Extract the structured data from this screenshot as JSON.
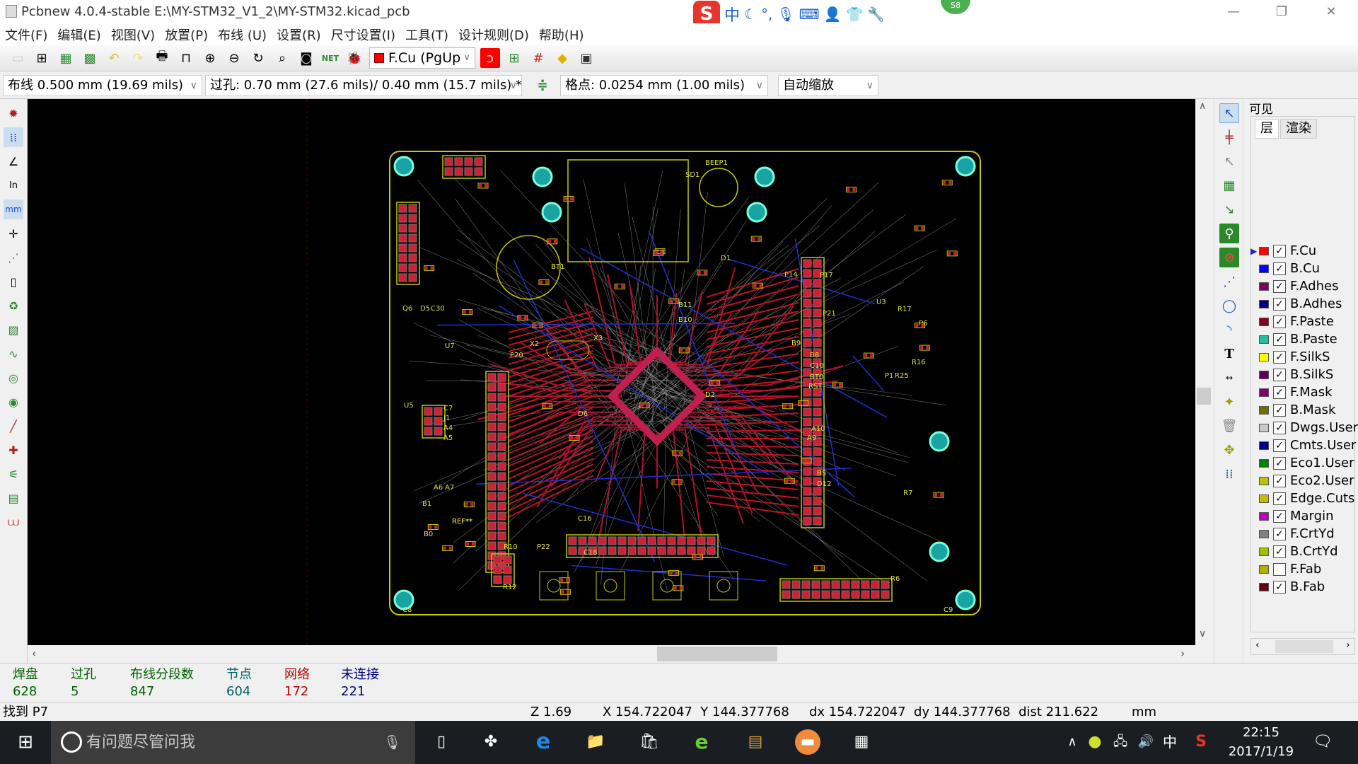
{
  "window": {
    "title": "Pcbnew 4.0.4-stable E:\\MY-STM32_V1_2\\MY-STM32.kicad_pcb",
    "minimize": "—",
    "maximize": "❐",
    "close": "✕"
  },
  "menu": [
    "文件(F)",
    "编辑(E)",
    "视图(V)",
    "放置(P)",
    "布线 (U)",
    "设置(R)",
    "尺寸设置(I)",
    "工具(T)",
    "设计规则(D)",
    "帮助(H)"
  ],
  "toolbar": {
    "layer_select": "F.Cu (PgUp",
    "ime_badge": "S8"
  },
  "toolbar2": {
    "track_width": "布线 0.500 mm (19.69 mils)",
    "via_size": "过孔: 0.70 mm (27.6 mils)/ 0.40 mm (15.7 mils) *",
    "grid": "格点: 0.0254 mm (1.00 mils)",
    "zoom": "自动缩放"
  },
  "layers_panel": {
    "title": "可见",
    "tabs": [
      "层",
      "渲染"
    ],
    "active_layer": "F.Cu",
    "items": [
      {
        "name": "F.Cu",
        "color": "#ff0000",
        "visible": true
      },
      {
        "name": "B.Cu",
        "color": "#0000ff",
        "visible": true
      },
      {
        "name": "F.Adhes",
        "color": "#800060",
        "visible": true
      },
      {
        "name": "B.Adhes",
        "color": "#000080",
        "visible": true
      },
      {
        "name": "F.Paste",
        "color": "#800020",
        "visible": true
      },
      {
        "name": "B.Paste",
        "color": "#20c0a0",
        "visible": true
      },
      {
        "name": "F.SilkS",
        "color": "#ffff00",
        "visible": true
      },
      {
        "name": "B.SilkS",
        "color": "#600060",
        "visible": true
      },
      {
        "name": "F.Mask",
        "color": "#800070",
        "visible": true
      },
      {
        "name": "B.Mask",
        "color": "#707000",
        "visible": true
      },
      {
        "name": "Dwgs.User",
        "color": "#c8c8c8",
        "visible": true
      },
      {
        "name": "Cmts.User",
        "color": "#000090",
        "visible": true
      },
      {
        "name": "Eco1.User",
        "color": "#008000",
        "visible": true
      },
      {
        "name": "Eco2.User",
        "color": "#c0c000",
        "visible": true
      },
      {
        "name": "Edge.Cuts",
        "color": "#c0c000",
        "visible": true
      },
      {
        "name": "Margin",
        "color": "#c000c0",
        "visible": true
      },
      {
        "name": "F.CrtYd",
        "color": "#808080",
        "visible": true
      },
      {
        "name": "B.CrtYd",
        "color": "#a0c000",
        "visible": true
      },
      {
        "name": "F.Fab",
        "color": "#b0b000",
        "visible": false
      },
      {
        "name": "B.Fab",
        "color": "#600010",
        "visible": true
      }
    ]
  },
  "board": {
    "labels": [
      "BEEP1",
      "SD1",
      "BT1",
      "U7",
      "X2",
      "X3",
      "U5",
      "P20",
      "P21",
      "P22",
      "P14",
      "P17",
      "B9",
      "B8",
      "C10",
      "BT0",
      "RST",
      "A10",
      "A9",
      "B5",
      "D12",
      "B11",
      "B10",
      "D1",
      "D2",
      "D6",
      "C16",
      "C18",
      "R10",
      "R12",
      "R6",
      "R7",
      "C7",
      "J1",
      "A4",
      "A5",
      "A6",
      "A7",
      "B0",
      "B1",
      "Q6",
      "D5",
      "C30",
      "R16",
      "R17",
      "P6",
      "U3",
      "P1",
      "R25",
      "C8",
      "C9",
      "REF**",
      "REF**"
    ]
  },
  "messages": [
    {
      "label": "焊盘",
      "value": "628",
      "color": "#006000"
    },
    {
      "label": "过孔",
      "value": "5",
      "color": "#006000"
    },
    {
      "label": "布线分段数",
      "value": "847",
      "color": "#006000"
    },
    {
      "label": "节点",
      "value": "604",
      "color": "#006060"
    },
    {
      "label": "网络",
      "value": "172",
      "color": "#c00000"
    },
    {
      "label": "未连接",
      "value": "221",
      "color": "#000080"
    }
  ],
  "status": {
    "message": "找到 P7",
    "zoom": "Z 1.69",
    "xy": "X 154.722047  Y 144.377768",
    "delta": "dx 154.722047  dy 144.377768  dist 211.622",
    "units": "mm"
  },
  "taskbar": {
    "search_placeholder": "有问题尽管问我",
    "time": "22:15",
    "date": "2017/1/19",
    "ime": "中"
  }
}
